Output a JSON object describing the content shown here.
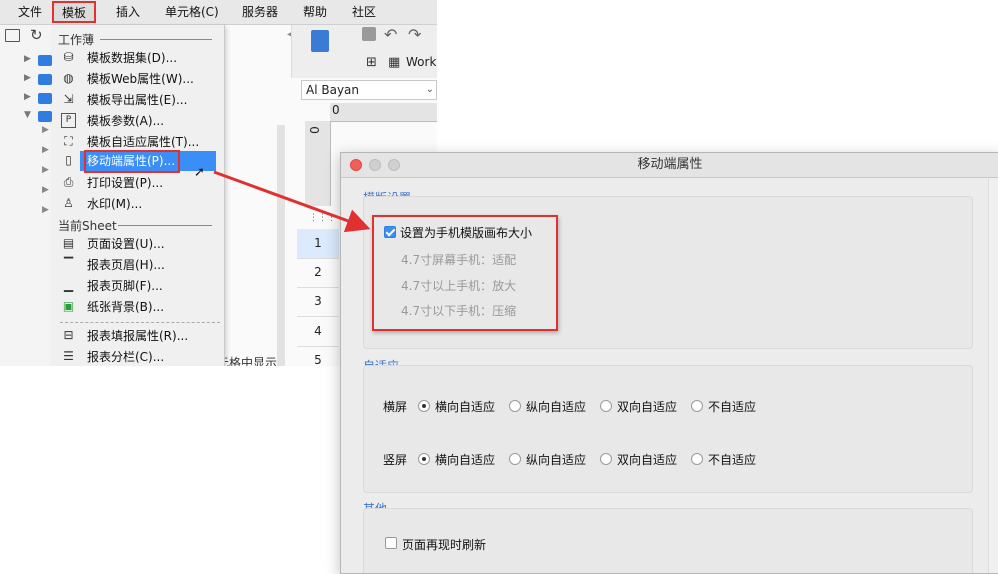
{
  "menubar": {
    "items": [
      "文件",
      "模板",
      "插入",
      "单元格(C)",
      "服务器",
      "帮助",
      "社区"
    ]
  },
  "menu": {
    "section_workbook": "工作薄",
    "section_sheet": "当前Sheet",
    "items": [
      {
        "label": "模板数据集(D)...",
        "icon": "database-icon"
      },
      {
        "label": "模板Web属性(W)...",
        "icon": "globe-icon"
      },
      {
        "label": "模板导出属性(E)...",
        "icon": "export-icon"
      },
      {
        "label": "模板参数(A)...",
        "icon": "parameter-icon"
      },
      {
        "label": "模板自适应属性(T)...",
        "icon": "adaptive-icon"
      },
      {
        "label": "移动端属性(P)...",
        "icon": "mobile-icon"
      },
      {
        "label": "打印设置(P)...",
        "icon": "printer-icon"
      },
      {
        "label": "水印(M)...",
        "icon": "stamp-icon"
      },
      {
        "label": "页面设置(U)...",
        "icon": "page-setup-icon"
      },
      {
        "label": "报表页眉(H)...",
        "icon": "header-icon"
      },
      {
        "label": "报表页脚(F)...",
        "icon": "footer-icon"
      },
      {
        "label": "纸张背景(B)...",
        "icon": "image-icon"
      },
      {
        "label": "报表填报属性(R)...",
        "icon": "fill-attr-icon"
      },
      {
        "label": "报表分栏(C)...",
        "icon": "columns-icon"
      }
    ]
  },
  "editor": {
    "toolbar_label": "Work",
    "font": "Al Bayan",
    "ruler_zero": "0",
    "rows": [
      "1",
      "2",
      "3",
      "4",
      "5"
    ],
    "partial_text": "元格中显示"
  },
  "dialog": {
    "title": "移动端属性",
    "template_section": "模版设置",
    "phone_canvas_checkbox": "设置为手机模版画布大小",
    "phone_canvas_checked": true,
    "hints": [
      "4.7寸屏幕手机：适配",
      "4.7寸以上手机：放大",
      "4.7寸以下手机：压缩"
    ],
    "adaptive_section": "自适应",
    "landscape_label": "横屏",
    "portrait_label": "竖屏",
    "adaptive_options": [
      "横向自适应",
      "纵向自适应",
      "双向自适应",
      "不自适应"
    ],
    "landscape_selected": 0,
    "portrait_selected": 0,
    "other_section": "其他",
    "refresh_checkbox": "页面再现时刷新",
    "refresh_checked": false
  },
  "colors": {
    "highlight": "#3a8ef6",
    "annotation_red": "#e03030",
    "section_blue": "#3b76c9"
  }
}
